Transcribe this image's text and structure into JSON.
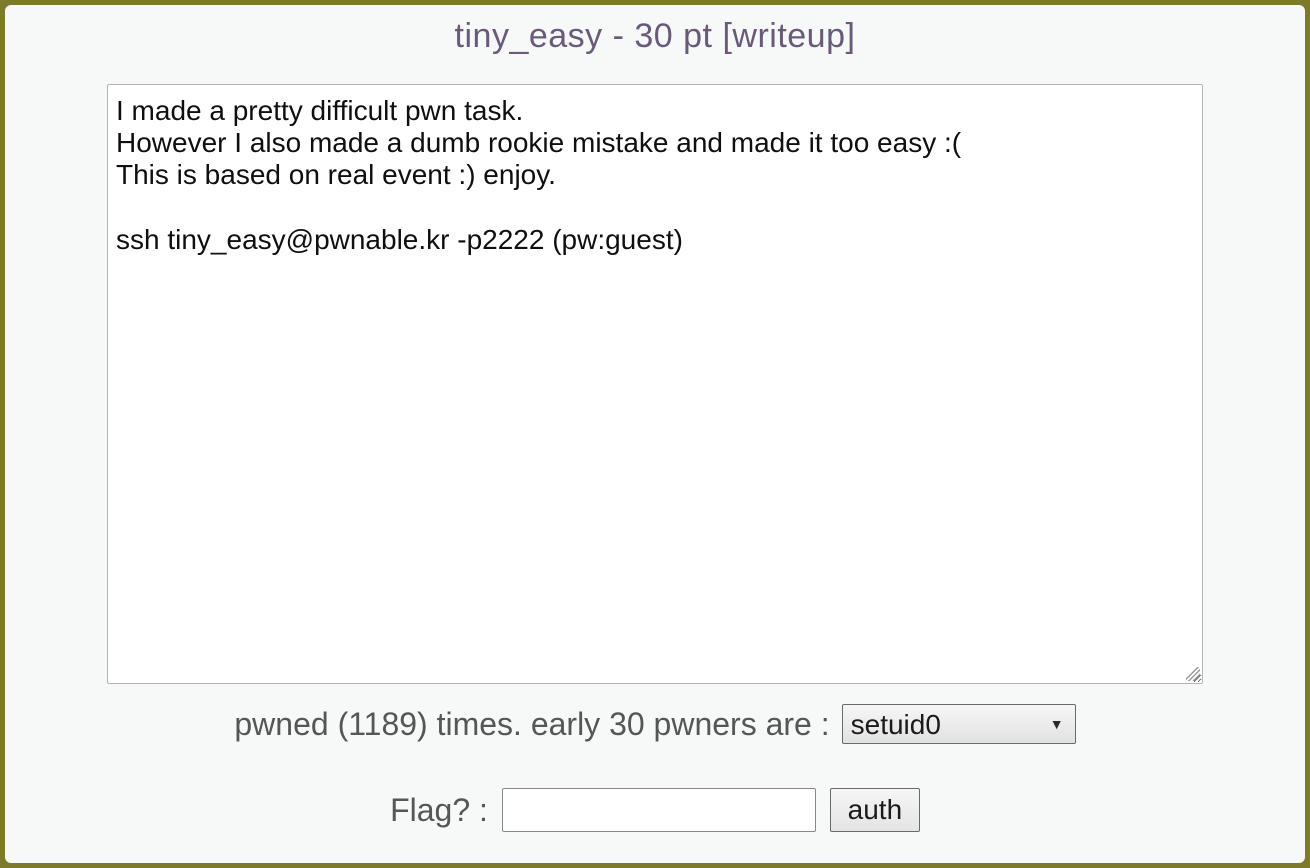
{
  "header": {
    "title": "tiny_easy - 30 pt [writeup]"
  },
  "description": {
    "text": "I made a pretty difficult pwn task.\nHowever I also made a dumb rookie mistake and made it too easy :(\nThis is based on real event :) enjoy.\n\nssh tiny_easy@pwnable.kr -p2222 (pw:guest)"
  },
  "stats": {
    "text": "pwned (1189) times. early 30 pwners are :",
    "selected_pwner": "setuid0"
  },
  "flag_form": {
    "label": "Flag? :",
    "input_value": "",
    "button_label": "auth"
  }
}
